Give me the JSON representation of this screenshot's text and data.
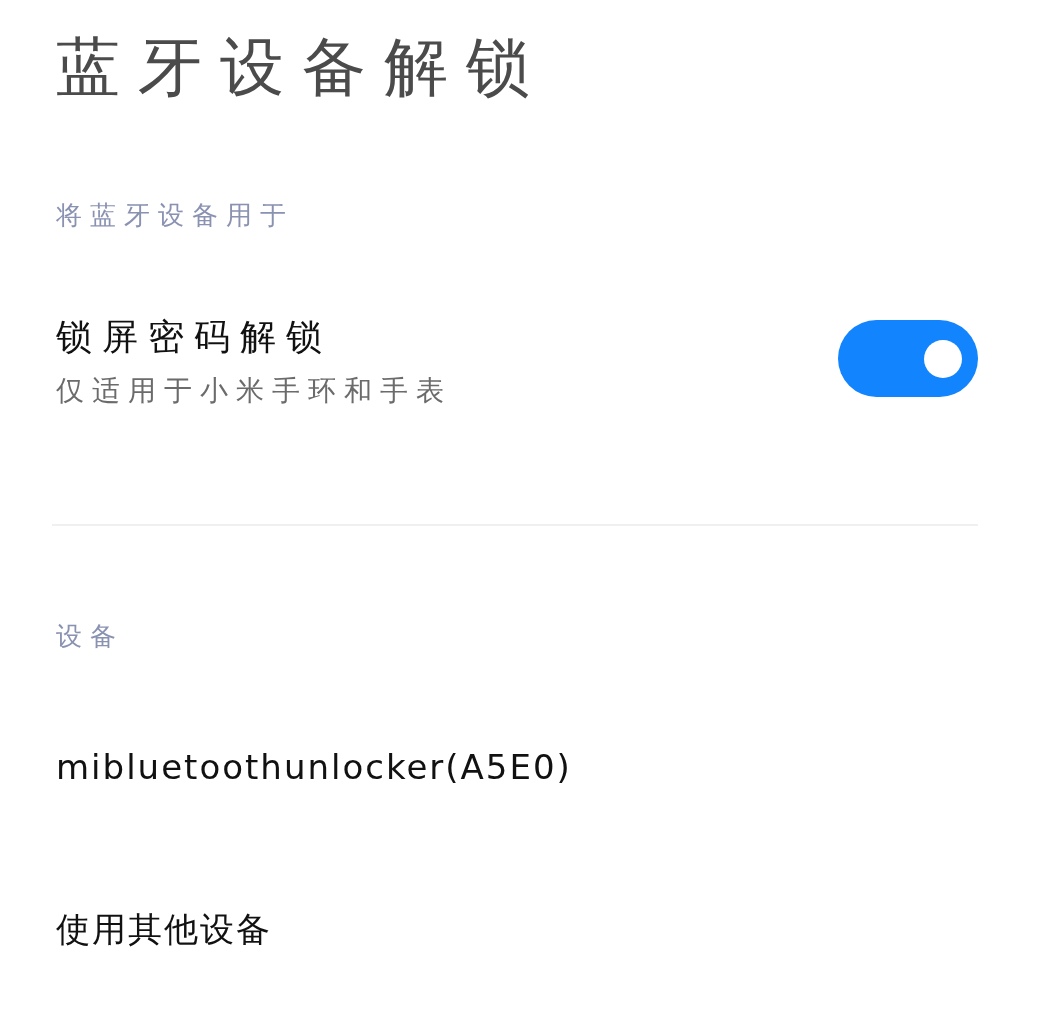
{
  "title": "蓝牙设备解锁",
  "sections": [
    {
      "header": "将蓝牙设备用于",
      "items": [
        {
          "kind": "toggle",
          "label": "锁屏密码解锁",
          "summary": "仅适用于小米手环和手表",
          "on": true
        }
      ]
    },
    {
      "header": "设备",
      "items": [
        {
          "kind": "link",
          "label": "mibluetoothunlocker(A5E0)"
        },
        {
          "kind": "link",
          "label": "使用其他设备"
        }
      ]
    }
  ]
}
